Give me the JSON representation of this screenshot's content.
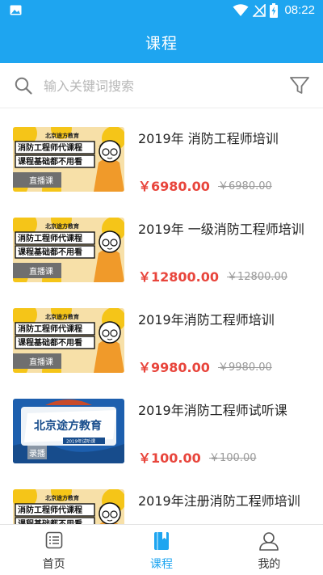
{
  "status_bar": {
    "time": "08:22"
  },
  "app_bar": {
    "title": "课程"
  },
  "search": {
    "placeholder": "输入关键词搜索"
  },
  "courses": [
    {
      "title": "2019年 消防工程师培训",
      "price": "￥6980.00",
      "original_price": "￥6980.00",
      "thumb": "yellow-banner"
    },
    {
      "title": "2019年 一级消防工程师培训",
      "price": "￥12800.00",
      "original_price": "￥12800.00",
      "thumb": "yellow-banner"
    },
    {
      "title": "2019年消防工程师培训",
      "price": "￥9980.00",
      "original_price": "￥9980.00",
      "thumb": "yellow-banner"
    },
    {
      "title": "2019年消防工程师试听课",
      "price": "￥100.00",
      "original_price": "￥100.00",
      "thumb": "blue-banner"
    },
    {
      "title": "2019年注册消防工程师培训",
      "price": "",
      "original_price": "",
      "thumb": "yellow-banner"
    }
  ],
  "thumb_yellow": {
    "top": "北京途方教育",
    "line1": "消防工程师代课程",
    "line2": "课程基础都不用看",
    "tag": "直播课"
  },
  "thumb_blue": {
    "brand": "北京途方教育",
    "sub": "2019年试听课",
    "tag": "录播"
  },
  "bottom_nav": [
    {
      "label": "首页",
      "icon": "list-icon",
      "active": false
    },
    {
      "label": "课程",
      "icon": "book-icon",
      "active": true
    },
    {
      "label": "我的",
      "icon": "user-icon",
      "active": false
    }
  ],
  "colors": {
    "primary": "#1ea5f0",
    "price": "#e8453c",
    "muted": "#9a9a9a"
  }
}
